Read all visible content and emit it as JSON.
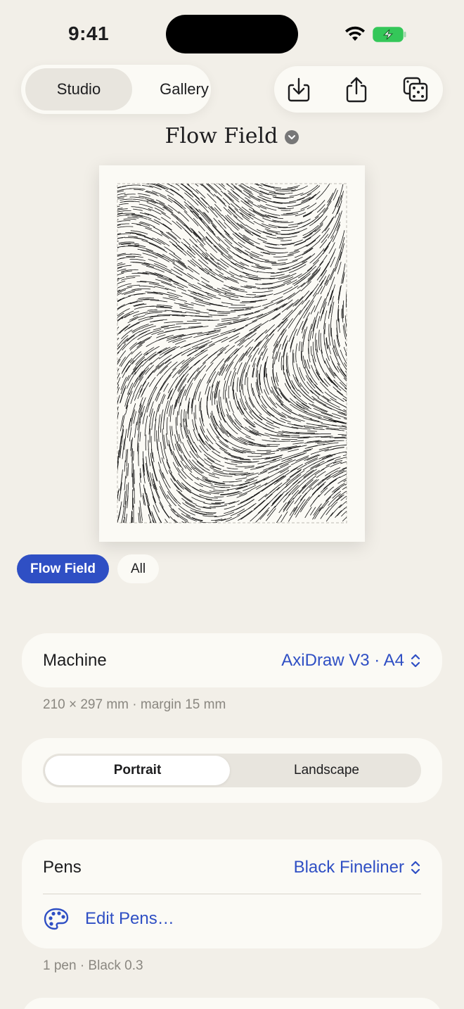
{
  "status": {
    "time": "9:41"
  },
  "top_segment": {
    "items": [
      {
        "label": "Studio",
        "active": true
      },
      {
        "label": "Gallery",
        "active": false
      }
    ]
  },
  "actions": {
    "icons": [
      "download-icon",
      "share-icon",
      "dice-icon"
    ]
  },
  "document": {
    "title": "Flow Field"
  },
  "filters": {
    "items": [
      {
        "label": "Flow Field",
        "active": true
      },
      {
        "label": "All",
        "active": false
      }
    ]
  },
  "machine": {
    "label": "Machine",
    "value": "AxiDraw V3 · A4",
    "caption": "210 × 297 mm · margin 15 mm"
  },
  "orientation": {
    "options": [
      "Portrait",
      "Landscape"
    ],
    "selected": "Portrait"
  },
  "pens": {
    "label": "Pens",
    "value": "Black Fineliner",
    "edit_label": "Edit Pens…",
    "caption": "1 pen · Black 0.3"
  },
  "colors": {
    "accent": "#2f4fc4",
    "background": "#f2efe8",
    "card": "#fbfaf5",
    "battery": "#34c759"
  }
}
